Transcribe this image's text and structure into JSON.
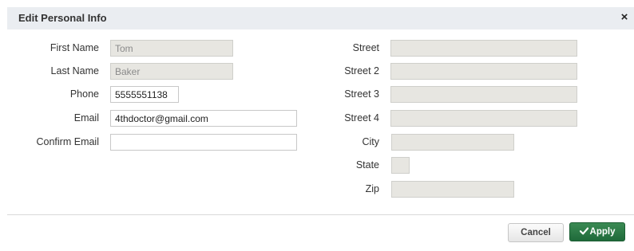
{
  "dialog": {
    "title": "Edit Personal Info",
    "close_glyph": "×"
  },
  "left_fields": {
    "first_name": {
      "label": "First Name",
      "value": "Tom"
    },
    "last_name": {
      "label": "Last Name",
      "value": "Baker"
    },
    "phone": {
      "label": "Phone",
      "value": "5555551138"
    },
    "email": {
      "label": "Email",
      "value": "4thdoctor@gmail.com"
    },
    "confirm_email": {
      "label": "Confirm Email",
      "value": ""
    }
  },
  "right_fields": {
    "street": {
      "label": "Street",
      "value": ""
    },
    "street2": {
      "label": "Street 2",
      "value": ""
    },
    "street3": {
      "label": "Street 3",
      "value": ""
    },
    "street4": {
      "label": "Street 4",
      "value": ""
    },
    "city": {
      "label": "City",
      "value": ""
    },
    "state": {
      "label": "State",
      "value": ""
    },
    "zip": {
      "label": "Zip",
      "value": ""
    }
  },
  "buttons": {
    "cancel": "Cancel",
    "apply": "Apply"
  },
  "colors": {
    "titlebar": "#eaedf1",
    "readonly_field": "#e7e6e1",
    "apply_button": "#2a7a45"
  },
  "icons": {
    "close": "close-icon",
    "apply": "check-icon"
  }
}
